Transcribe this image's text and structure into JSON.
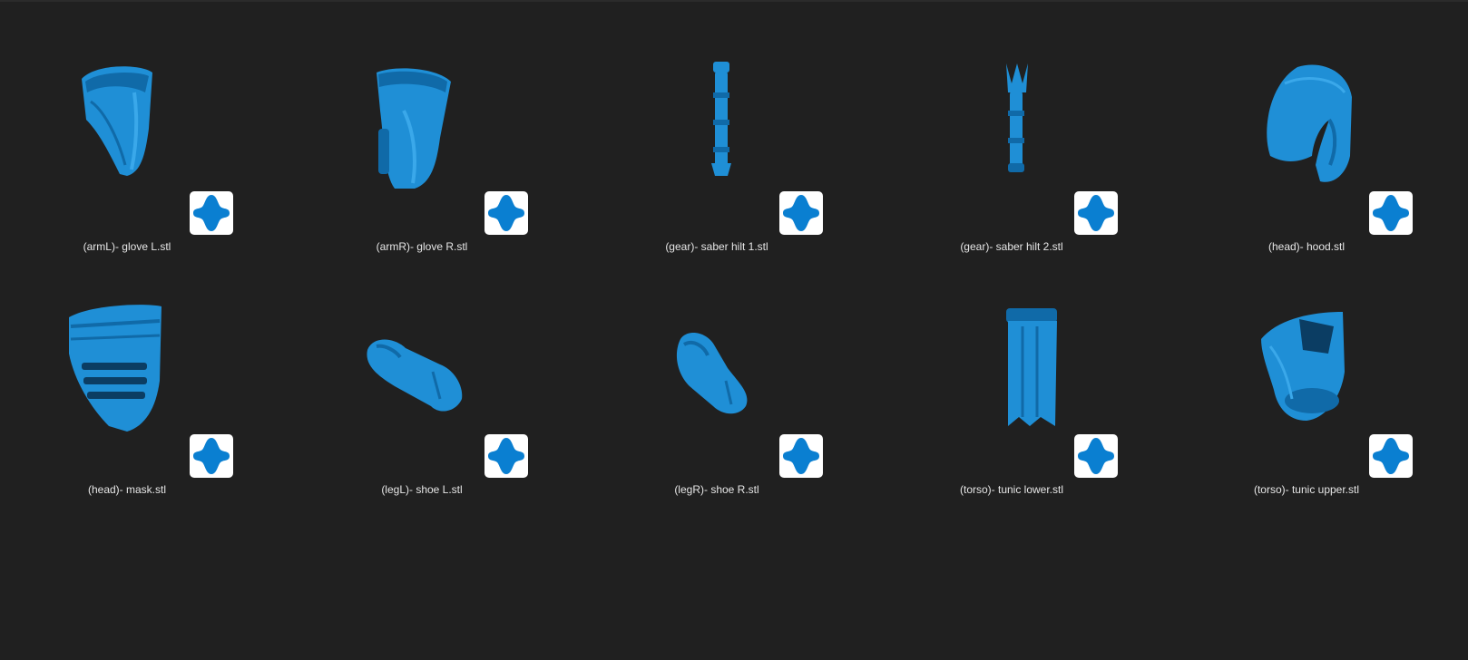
{
  "window": {
    "background": "#202020"
  },
  "colors": {
    "model": "#1f8fd6",
    "model_dark": "#106aa8",
    "badge_icon": "#0a7fd1",
    "label": "#e6e6e6"
  },
  "badge_icon_name": "stl-file-app-icon",
  "files": [
    {
      "name": "(armL)- glove L.stl",
      "thumbnail": "glove-left-model-icon"
    },
    {
      "name": "(armR)- glove R.stl",
      "thumbnail": "glove-right-model-icon"
    },
    {
      "name": "(gear)- saber hilt 1.stl",
      "thumbnail": "saber-hilt-1-model-icon"
    },
    {
      "name": "(gear)- saber hilt 2.stl",
      "thumbnail": "saber-hilt-2-model-icon"
    },
    {
      "name": "(head)- hood.stl",
      "thumbnail": "hood-model-icon"
    },
    {
      "name": "(head)- mask.stl",
      "thumbnail": "mask-model-icon"
    },
    {
      "name": "(legL)- shoe L.stl",
      "thumbnail": "shoe-left-model-icon"
    },
    {
      "name": "(legR)- shoe R.stl",
      "thumbnail": "shoe-right-model-icon"
    },
    {
      "name": "(torso)- tunic lower.stl",
      "thumbnail": "tunic-lower-model-icon"
    },
    {
      "name": "(torso)- tunic upper.stl",
      "thumbnail": "tunic-upper-model-icon"
    }
  ]
}
